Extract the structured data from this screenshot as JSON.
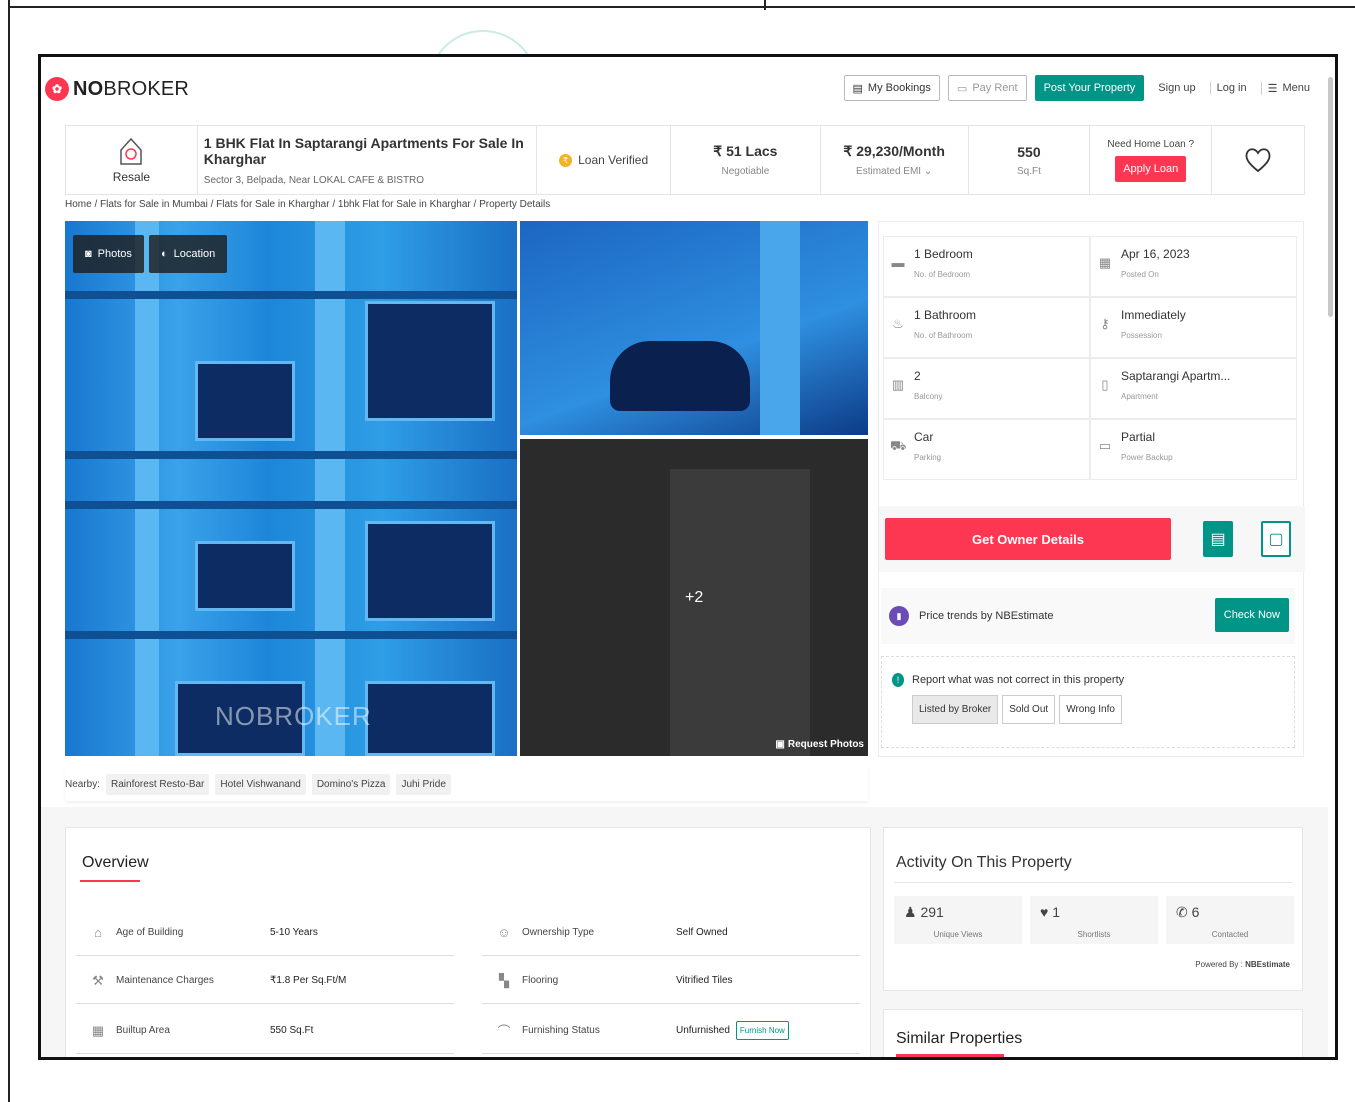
{
  "nav": {
    "brand_bold": "NO",
    "brand_rest": "BROKER",
    "my_bookings": "My Bookings",
    "pay_rent": "Pay Rent",
    "post_property": "Post Your Property",
    "sign_up": "Sign up",
    "log_in": "Log in",
    "menu": "Menu"
  },
  "header": {
    "resale": "Resale",
    "title": "1 BHK Flat In Saptarangi Apartments For Sale In Kharghar",
    "address": "Sector 3, Belpada, Near LOKAL CAFE & BISTRO",
    "loan_verified": "Loan Verified",
    "price": "₹ 51 Lacs",
    "price_sub": "Negotiable",
    "emi": "₹ 29,230/Month",
    "emi_sub": "Estimated EMI ⌄",
    "area": "550",
    "area_sub": "Sq.Ft",
    "loan_q": "Need Home Loan ?",
    "apply_loan": "Apply Loan"
  },
  "breadcrumb": "Home / Flats for Sale in Mumbai / Flats for Sale in Kharghar / 1bhk Flat for Sale in Kharghar / Property Details",
  "gallery": {
    "photos": "Photos",
    "location": "Location",
    "watermark": "NOBROKER",
    "more": "+2",
    "request": "Request Photos"
  },
  "nearby": {
    "label": "Nearby:",
    "items": [
      "Rainforest Resto-Bar",
      "Hotel Vishwanand",
      "Domino's Pizza",
      "Juhi Pride"
    ]
  },
  "specs": [
    {
      "value": "1 Bedroom",
      "label": "No. of Bedroom",
      "icon": "bed-icon"
    },
    {
      "value": "Apr 16, 2023",
      "label": "Posted On",
      "icon": "calendar-icon"
    },
    {
      "value": "1 Bathroom",
      "label": "No. of Bathroom",
      "icon": "bath-icon"
    },
    {
      "value": "Immediately",
      "label": "Possession",
      "icon": "key-icon"
    },
    {
      "value": "2",
      "label": "Balcony",
      "icon": "balcony-icon"
    },
    {
      "value": "Saptarangi Apartm...",
      "label": "Apartment",
      "icon": "building-icon"
    },
    {
      "value": "Car",
      "label": "Parking",
      "icon": "car-icon"
    },
    {
      "value": "Partial",
      "label": "Power Backup",
      "icon": "battery-icon"
    }
  ],
  "actions": {
    "owner": "Get Owner Details",
    "trend": "Price trends by NBEstimate",
    "check": "Check Now"
  },
  "report": {
    "title": "Report what was not correct in this property",
    "options": [
      "Listed by Broker",
      "Sold Out",
      "Wrong Info"
    ]
  },
  "overview": {
    "title": "Overview",
    "rows_left": [
      {
        "key": "Age of Building",
        "value": "5-10 Years",
        "icon": "building-age-icon"
      },
      {
        "key": "Maintenance Charges",
        "value": "₹1.8 Per Sq.Ft/M",
        "icon": "tools-icon"
      },
      {
        "key": "Builtup Area",
        "value": "550 Sq.Ft",
        "icon": "area-icon"
      }
    ],
    "rows_right": [
      {
        "key": "Ownership Type",
        "value": "Self Owned",
        "icon": "owner-icon"
      },
      {
        "key": "Flooring",
        "value": "Vitrified Tiles",
        "icon": "flooring-icon"
      },
      {
        "key": "Furnishing Status",
        "value": "Unfurnished",
        "icon": "sofa-icon"
      }
    ],
    "furnish_now": "Furnish Now"
  },
  "activity": {
    "title": "Activity On This Property",
    "views": "291",
    "views_label": "Unique Views",
    "shortlists": "1",
    "shortlists_label": "Shortlists",
    "contacted": "6",
    "contacted_label": "Contacted",
    "powered_prefix": "Powered By : ",
    "powered_brand": "NBEstimate"
  },
  "similar": {
    "title": "Similar Properties"
  },
  "colors": {
    "brand_red": "#fd3752",
    "brand_green": "#009587"
  }
}
